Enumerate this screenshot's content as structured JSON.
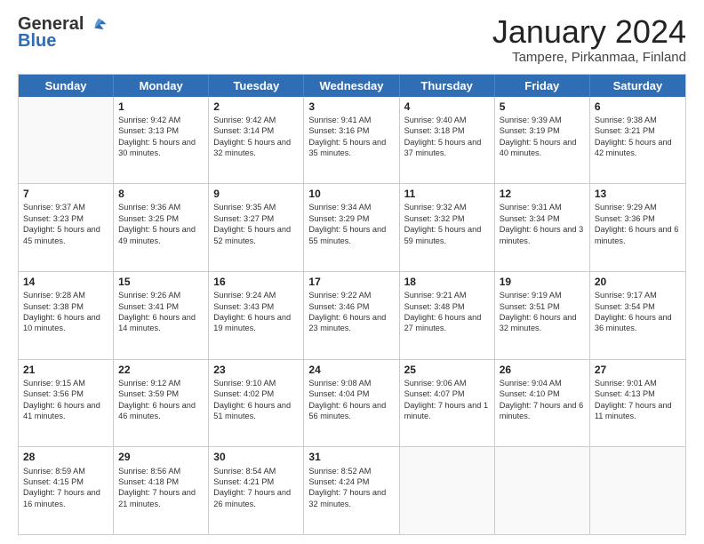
{
  "header": {
    "logo_general": "General",
    "logo_blue": "Blue",
    "month_title": "January 2024",
    "location": "Tampere, Pirkanmaa, Finland"
  },
  "days_of_week": [
    "Sunday",
    "Monday",
    "Tuesday",
    "Wednesday",
    "Thursday",
    "Friday",
    "Saturday"
  ],
  "weeks": [
    [
      {
        "day": "",
        "sunrise": "",
        "sunset": "",
        "daylight": ""
      },
      {
        "day": "1",
        "sunrise": "Sunrise: 9:42 AM",
        "sunset": "Sunset: 3:13 PM",
        "daylight": "Daylight: 5 hours and 30 minutes."
      },
      {
        "day": "2",
        "sunrise": "Sunrise: 9:42 AM",
        "sunset": "Sunset: 3:14 PM",
        "daylight": "Daylight: 5 hours and 32 minutes."
      },
      {
        "day": "3",
        "sunrise": "Sunrise: 9:41 AM",
        "sunset": "Sunset: 3:16 PM",
        "daylight": "Daylight: 5 hours and 35 minutes."
      },
      {
        "day": "4",
        "sunrise": "Sunrise: 9:40 AM",
        "sunset": "Sunset: 3:18 PM",
        "daylight": "Daylight: 5 hours and 37 minutes."
      },
      {
        "day": "5",
        "sunrise": "Sunrise: 9:39 AM",
        "sunset": "Sunset: 3:19 PM",
        "daylight": "Daylight: 5 hours and 40 minutes."
      },
      {
        "day": "6",
        "sunrise": "Sunrise: 9:38 AM",
        "sunset": "Sunset: 3:21 PM",
        "daylight": "Daylight: 5 hours and 42 minutes."
      }
    ],
    [
      {
        "day": "7",
        "sunrise": "Sunrise: 9:37 AM",
        "sunset": "Sunset: 3:23 PM",
        "daylight": "Daylight: 5 hours and 45 minutes."
      },
      {
        "day": "8",
        "sunrise": "Sunrise: 9:36 AM",
        "sunset": "Sunset: 3:25 PM",
        "daylight": "Daylight: 5 hours and 49 minutes."
      },
      {
        "day": "9",
        "sunrise": "Sunrise: 9:35 AM",
        "sunset": "Sunset: 3:27 PM",
        "daylight": "Daylight: 5 hours and 52 minutes."
      },
      {
        "day": "10",
        "sunrise": "Sunrise: 9:34 AM",
        "sunset": "Sunset: 3:29 PM",
        "daylight": "Daylight: 5 hours and 55 minutes."
      },
      {
        "day": "11",
        "sunrise": "Sunrise: 9:32 AM",
        "sunset": "Sunset: 3:32 PM",
        "daylight": "Daylight: 5 hours and 59 minutes."
      },
      {
        "day": "12",
        "sunrise": "Sunrise: 9:31 AM",
        "sunset": "Sunset: 3:34 PM",
        "daylight": "Daylight: 6 hours and 3 minutes."
      },
      {
        "day": "13",
        "sunrise": "Sunrise: 9:29 AM",
        "sunset": "Sunset: 3:36 PM",
        "daylight": "Daylight: 6 hours and 6 minutes."
      }
    ],
    [
      {
        "day": "14",
        "sunrise": "Sunrise: 9:28 AM",
        "sunset": "Sunset: 3:38 PM",
        "daylight": "Daylight: 6 hours and 10 minutes."
      },
      {
        "day": "15",
        "sunrise": "Sunrise: 9:26 AM",
        "sunset": "Sunset: 3:41 PM",
        "daylight": "Daylight: 6 hours and 14 minutes."
      },
      {
        "day": "16",
        "sunrise": "Sunrise: 9:24 AM",
        "sunset": "Sunset: 3:43 PM",
        "daylight": "Daylight: 6 hours and 19 minutes."
      },
      {
        "day": "17",
        "sunrise": "Sunrise: 9:22 AM",
        "sunset": "Sunset: 3:46 PM",
        "daylight": "Daylight: 6 hours and 23 minutes."
      },
      {
        "day": "18",
        "sunrise": "Sunrise: 9:21 AM",
        "sunset": "Sunset: 3:48 PM",
        "daylight": "Daylight: 6 hours and 27 minutes."
      },
      {
        "day": "19",
        "sunrise": "Sunrise: 9:19 AM",
        "sunset": "Sunset: 3:51 PM",
        "daylight": "Daylight: 6 hours and 32 minutes."
      },
      {
        "day": "20",
        "sunrise": "Sunrise: 9:17 AM",
        "sunset": "Sunset: 3:54 PM",
        "daylight": "Daylight: 6 hours and 36 minutes."
      }
    ],
    [
      {
        "day": "21",
        "sunrise": "Sunrise: 9:15 AM",
        "sunset": "Sunset: 3:56 PM",
        "daylight": "Daylight: 6 hours and 41 minutes."
      },
      {
        "day": "22",
        "sunrise": "Sunrise: 9:12 AM",
        "sunset": "Sunset: 3:59 PM",
        "daylight": "Daylight: 6 hours and 46 minutes."
      },
      {
        "day": "23",
        "sunrise": "Sunrise: 9:10 AM",
        "sunset": "Sunset: 4:02 PM",
        "daylight": "Daylight: 6 hours and 51 minutes."
      },
      {
        "day": "24",
        "sunrise": "Sunrise: 9:08 AM",
        "sunset": "Sunset: 4:04 PM",
        "daylight": "Daylight: 6 hours and 56 minutes."
      },
      {
        "day": "25",
        "sunrise": "Sunrise: 9:06 AM",
        "sunset": "Sunset: 4:07 PM",
        "daylight": "Daylight: 7 hours and 1 minute."
      },
      {
        "day": "26",
        "sunrise": "Sunrise: 9:04 AM",
        "sunset": "Sunset: 4:10 PM",
        "daylight": "Daylight: 7 hours and 6 minutes."
      },
      {
        "day": "27",
        "sunrise": "Sunrise: 9:01 AM",
        "sunset": "Sunset: 4:13 PM",
        "daylight": "Daylight: 7 hours and 11 minutes."
      }
    ],
    [
      {
        "day": "28",
        "sunrise": "Sunrise: 8:59 AM",
        "sunset": "Sunset: 4:15 PM",
        "daylight": "Daylight: 7 hours and 16 minutes."
      },
      {
        "day": "29",
        "sunrise": "Sunrise: 8:56 AM",
        "sunset": "Sunset: 4:18 PM",
        "daylight": "Daylight: 7 hours and 21 minutes."
      },
      {
        "day": "30",
        "sunrise": "Sunrise: 8:54 AM",
        "sunset": "Sunset: 4:21 PM",
        "daylight": "Daylight: 7 hours and 26 minutes."
      },
      {
        "day": "31",
        "sunrise": "Sunrise: 8:52 AM",
        "sunset": "Sunset: 4:24 PM",
        "daylight": "Daylight: 7 hours and 32 minutes."
      },
      {
        "day": "",
        "sunrise": "",
        "sunset": "",
        "daylight": ""
      },
      {
        "day": "",
        "sunrise": "",
        "sunset": "",
        "daylight": ""
      },
      {
        "day": "",
        "sunrise": "",
        "sunset": "",
        "daylight": ""
      }
    ]
  ]
}
